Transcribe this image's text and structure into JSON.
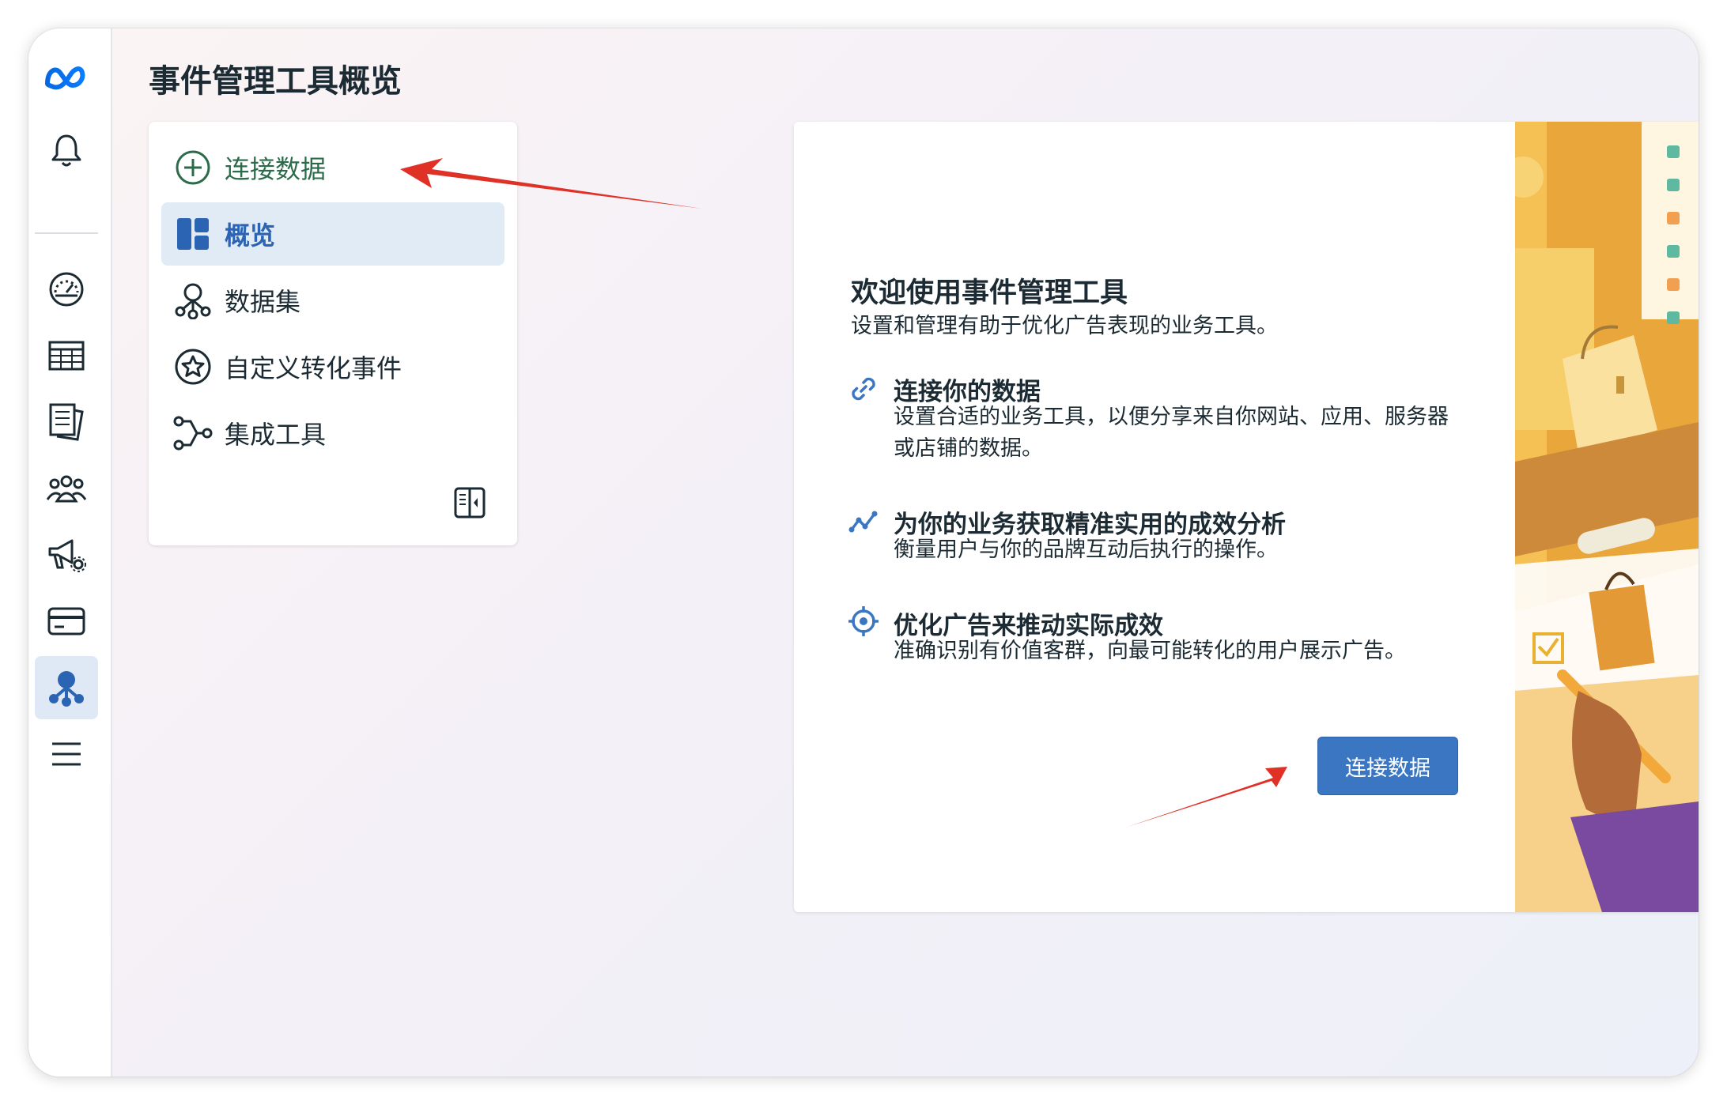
{
  "page": {
    "title": "事件管理工具概览"
  },
  "rail": {
    "items": [
      {
        "icon": "meta-logo-icon"
      },
      {
        "icon": "bell-icon"
      },
      {
        "icon": "dashboard-gauge-icon"
      },
      {
        "icon": "table-icon"
      },
      {
        "icon": "pages-icon"
      },
      {
        "icon": "audience-icon"
      },
      {
        "icon": "megaphone-settings-icon"
      },
      {
        "icon": "billing-card-icon"
      },
      {
        "icon": "events-manager-icon",
        "active": true
      },
      {
        "icon": "menu-icon"
      }
    ]
  },
  "nav": {
    "items": [
      {
        "label": "连接数据",
        "icon": "plus-circle-icon"
      },
      {
        "label": "概览",
        "icon": "overview-icon",
        "active": true
      },
      {
        "label": "数据集",
        "icon": "dataset-icon"
      },
      {
        "label": "自定义转化事件",
        "icon": "star-badge-icon"
      },
      {
        "label": "集成工具",
        "icon": "integration-icon"
      }
    ],
    "collapse_icon": "collapse-panel-icon"
  },
  "welcome": {
    "title": "欢迎使用事件管理工具",
    "subtitle": "设置和管理有助于优化广告表现的业务工具。",
    "features": [
      {
        "icon": "link-icon",
        "title": "连接你的数据",
        "desc": "设置合适的业务工具，以便分享来自你网站、应用、服务器或店铺的数据。"
      },
      {
        "icon": "analytics-icon",
        "title": "为你的业务获取精准实用的成效分析",
        "desc": "衡量用户与你的品牌互动后执行的操作。"
      },
      {
        "icon": "target-icon",
        "title": "优化广告来推动实际成效",
        "desc": "准确识别有价值客群，向最可能转化的用户展示广告。"
      }
    ],
    "cta_label": "连接数据"
  },
  "colors": {
    "accent": "#3a76c2",
    "connect_text": "#2b6b4a",
    "arrow": "#e03127",
    "illustration_bg": "#f2b84a"
  }
}
